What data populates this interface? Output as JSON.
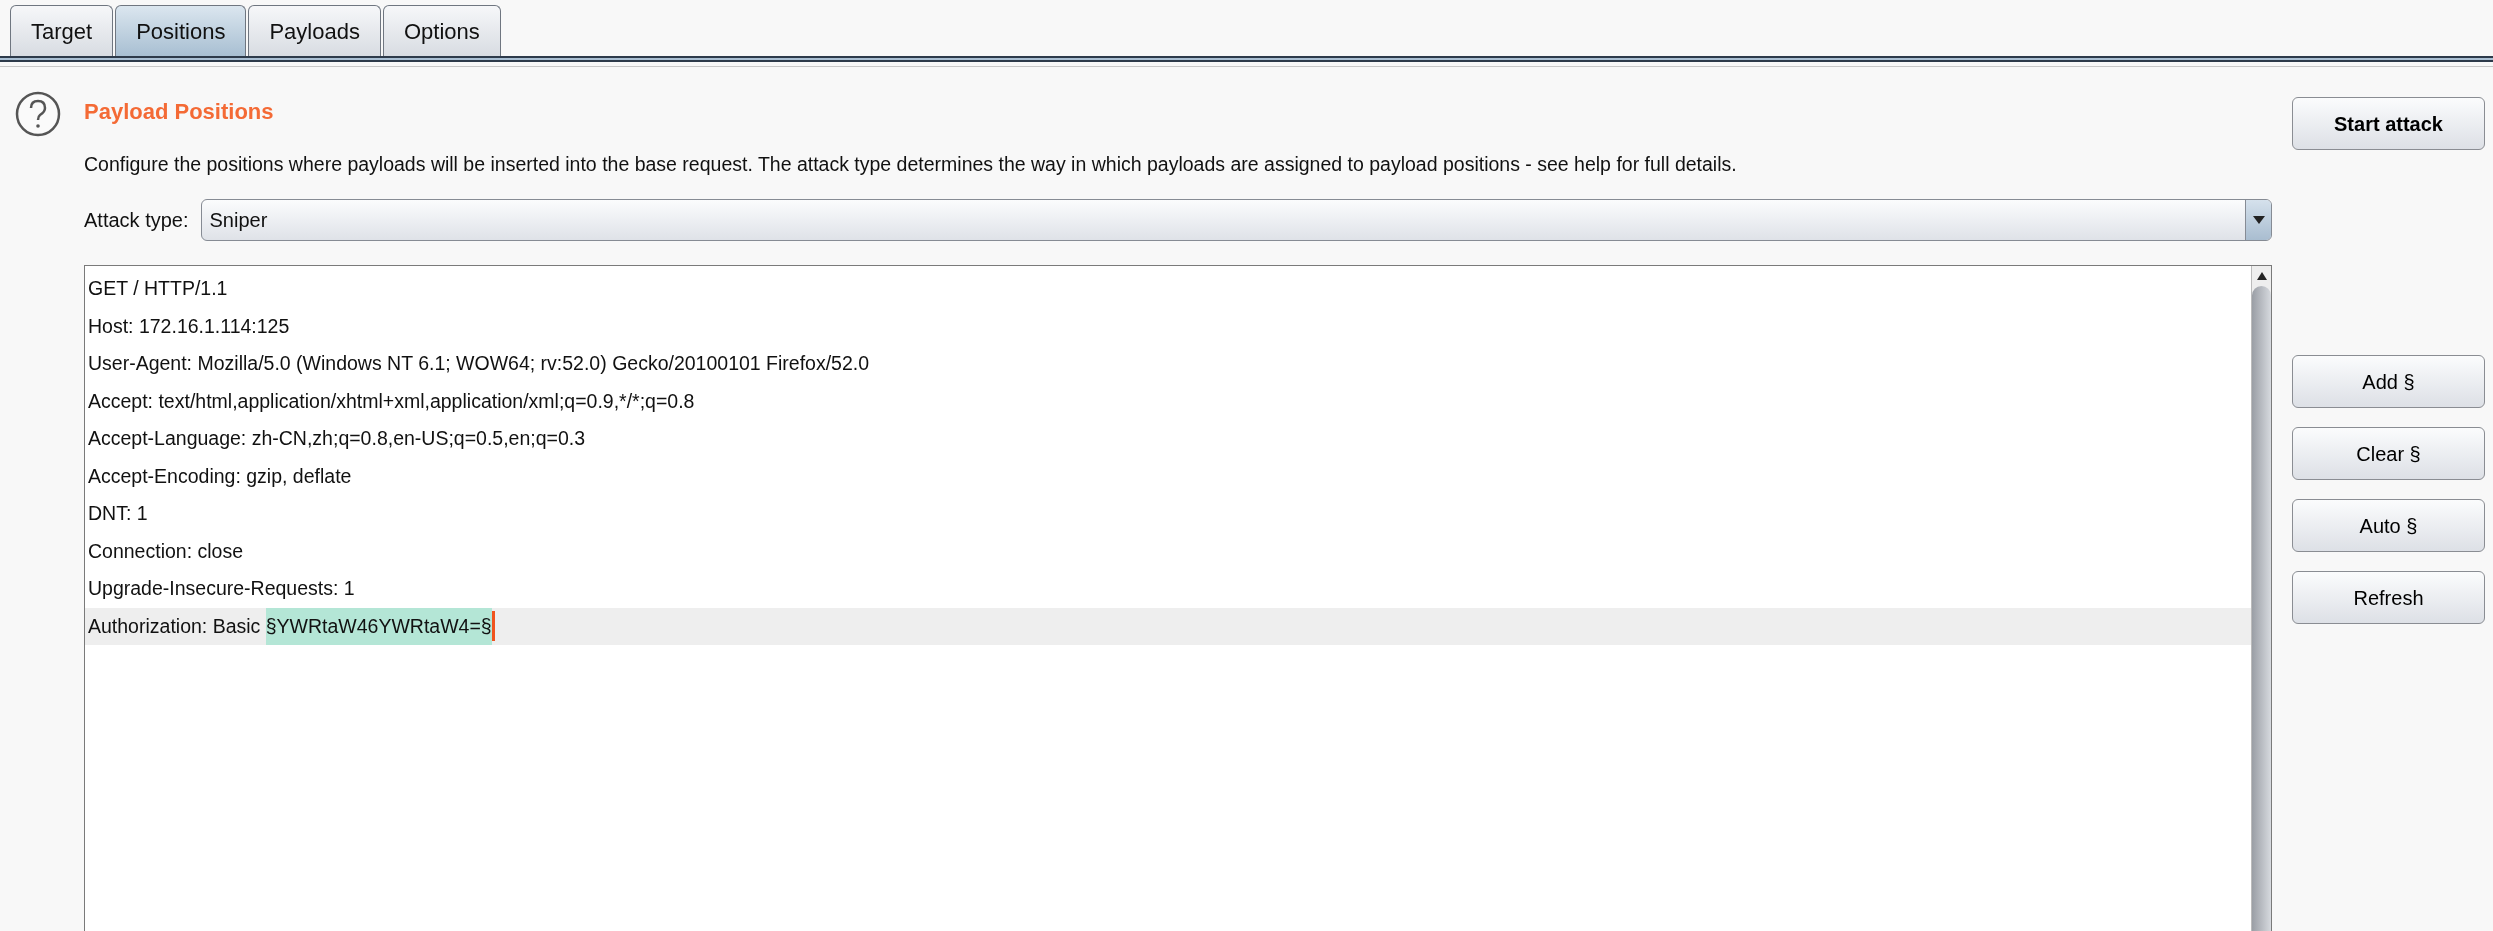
{
  "tabs": [
    {
      "label": "Target",
      "selected": false
    },
    {
      "label": "Positions",
      "selected": true
    },
    {
      "label": "Payloads",
      "selected": false
    },
    {
      "label": "Options",
      "selected": false
    }
  ],
  "section": {
    "title": "Payload Positions",
    "description": "Configure the positions where payloads will be inserted into the base request. The attack type determines the way in which payloads are assigned to payload positions - see help for full details."
  },
  "start_button": "Start attack",
  "attack_type": {
    "label": "Attack type:",
    "value": "Sniper"
  },
  "request_lines": [
    {
      "kind": "plain",
      "text": "GET / HTTP/1.1",
      "current": false
    },
    {
      "kind": "plain",
      "text": "Host: 172.16.1.114:125",
      "current": false
    },
    {
      "kind": "plain",
      "text": "User-Agent: Mozilla/5.0 (Windows NT 6.1; WOW64; rv:52.0) Gecko/20100101 Firefox/52.0",
      "current": false
    },
    {
      "kind": "plain",
      "text": "Accept: text/html,application/xhtml+xml,application/xml;q=0.9,*/*;q=0.8",
      "current": false
    },
    {
      "kind": "plain",
      "text": "Accept-Language: zh-CN,zh;q=0.8,en-US;q=0.5,en;q=0.3",
      "current": false
    },
    {
      "kind": "plain",
      "text": "Accept-Encoding: gzip, deflate",
      "current": false
    },
    {
      "kind": "plain",
      "text": "DNT: 1",
      "current": false
    },
    {
      "kind": "plain",
      "text": "Connection: close",
      "current": false
    },
    {
      "kind": "plain",
      "text": "Upgrade-Insecure-Requests: 1",
      "current": false
    },
    {
      "kind": "marked",
      "text": "Authorization: Basic ",
      "payload": "§YWRtaW46YWRtaW4=§",
      "current": true
    }
  ],
  "side_buttons": [
    "Add §",
    "Clear §",
    "Auto §",
    "Refresh"
  ]
}
